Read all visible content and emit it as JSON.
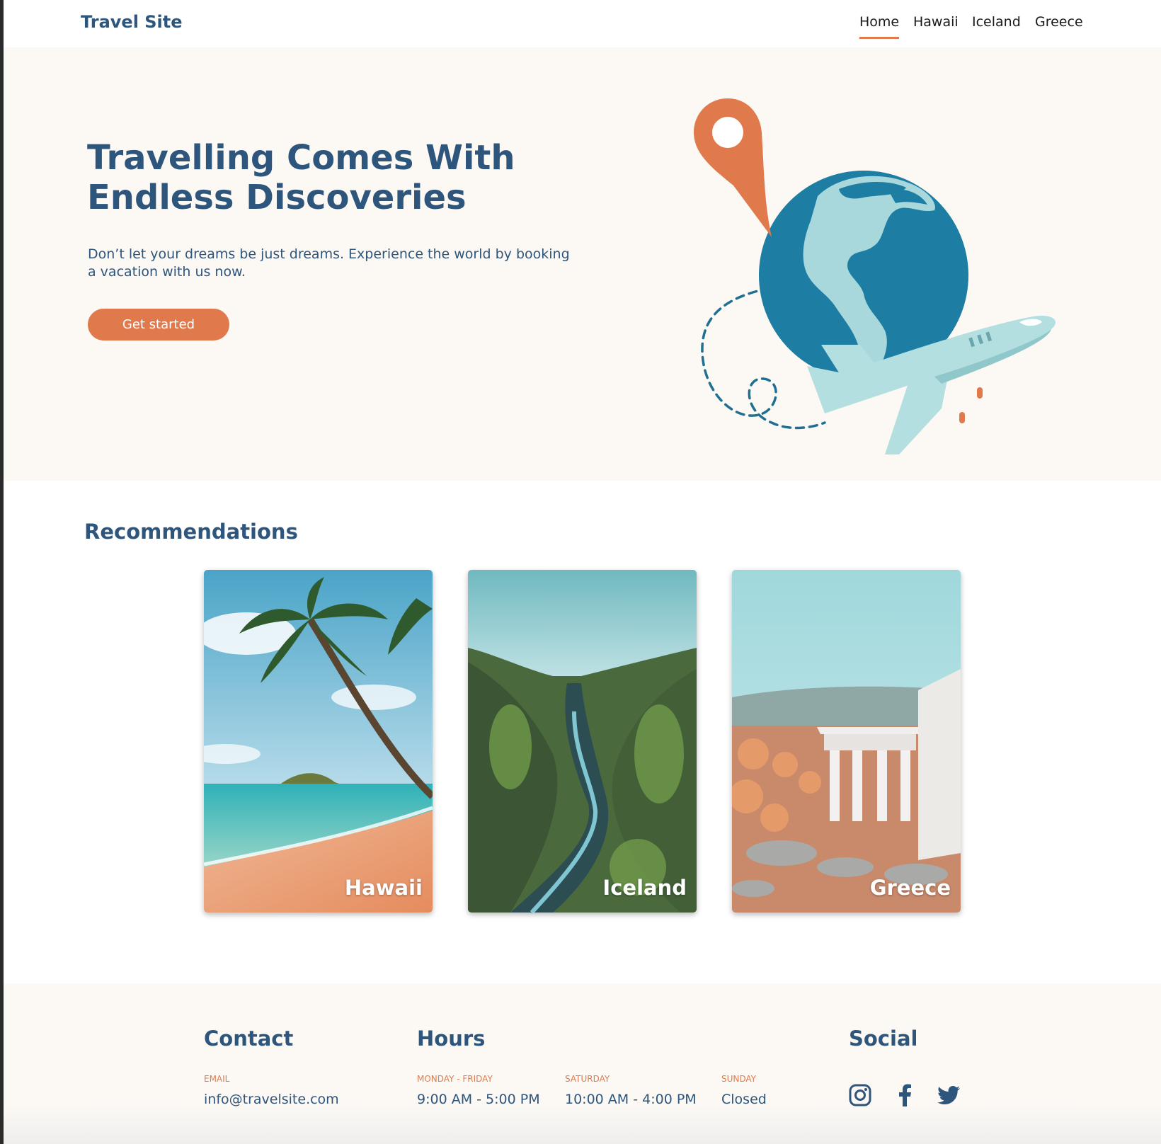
{
  "header": {
    "brand": "Travel Site",
    "nav": [
      {
        "label": "Home",
        "active": true
      },
      {
        "label": "Hawaii",
        "active": false
      },
      {
        "label": "Iceland",
        "active": false
      },
      {
        "label": "Greece",
        "active": false
      }
    ]
  },
  "hero": {
    "title": "Travelling Comes With Endless Discoveries",
    "text": "Don’t let your dreams be just dreams. Experience the world by booking a vacation with us now.",
    "cta_label": "Get started",
    "illustration_icons": [
      "location-pin-icon",
      "globe-icon",
      "airplane-icon"
    ]
  },
  "recommendations": {
    "title": "Recommendations",
    "cards": [
      {
        "label": "Hawaii"
      },
      {
        "label": "Iceland"
      },
      {
        "label": "Greece"
      }
    ]
  },
  "footer": {
    "contact": {
      "title": "Contact",
      "email_label": "EMAIL",
      "email": "info@travelsite.com"
    },
    "hours": {
      "title": "Hours",
      "items": [
        {
          "day": "MONDAY - FRIDAY",
          "time": "9:00 AM - 5:00 PM"
        },
        {
          "day": "SATURDAY",
          "time": "10:00 AM - 4:00 PM"
        },
        {
          "day": "SUNDAY",
          "time": "Closed"
        }
      ]
    },
    "social": {
      "title": "Social",
      "icons": [
        "instagram-icon",
        "facebook-icon",
        "twitter-icon"
      ]
    }
  },
  "colors": {
    "primary": "#2e557c",
    "accent": "#e07a4d",
    "background": "#fcf9f5",
    "globe": "#1e7da3",
    "globe_land": "#a8d8dc",
    "plane": "#b3dfe1"
  }
}
